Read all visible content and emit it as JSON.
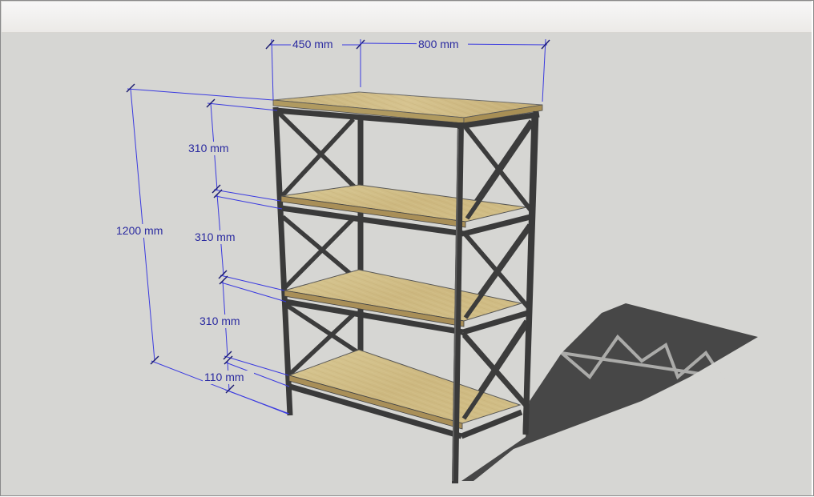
{
  "colors": {
    "background": "#d6d6d3",
    "dimension": "#2a2aa0",
    "frame": "#3a3a3a",
    "wood": "#cdb882",
    "shadow": "#4a4a4a"
  },
  "dimensions": {
    "depth": "450 mm",
    "width": "800 mm",
    "total_height": "1200 mm",
    "shelf_gap_1": "310 mm",
    "shelf_gap_2": "310 mm",
    "shelf_gap_3": "310 mm",
    "bottom_gap": "110 mm"
  }
}
